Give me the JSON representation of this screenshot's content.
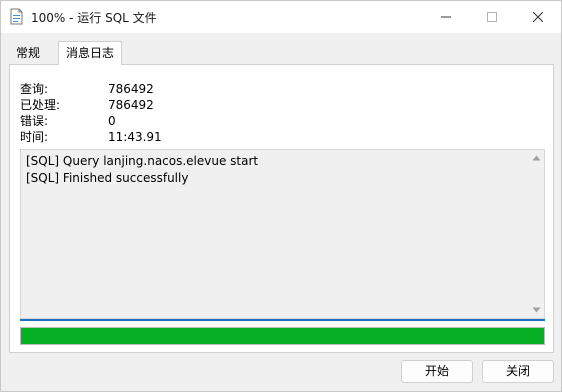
{
  "window": {
    "title": "100% - 运行 SQL 文件"
  },
  "tabs": [
    {
      "label": "常规",
      "active": false
    },
    {
      "label": "消息日志",
      "active": true
    }
  ],
  "stats": [
    {
      "label": "查询:",
      "value": "786492"
    },
    {
      "label": "已处理:",
      "value": "786492"
    },
    {
      "label": "错误:",
      "value": "0"
    },
    {
      "label": "时间:",
      "value": "11:43.91"
    }
  ],
  "log": {
    "lines": [
      "[SQL] Query lanjing.nacos.elevue start",
      "[SQL] Finished successfully"
    ]
  },
  "progress": {
    "fraction": 1.0,
    "color": "#06b025"
  },
  "buttons": {
    "start": "开始",
    "close": "关闭"
  }
}
